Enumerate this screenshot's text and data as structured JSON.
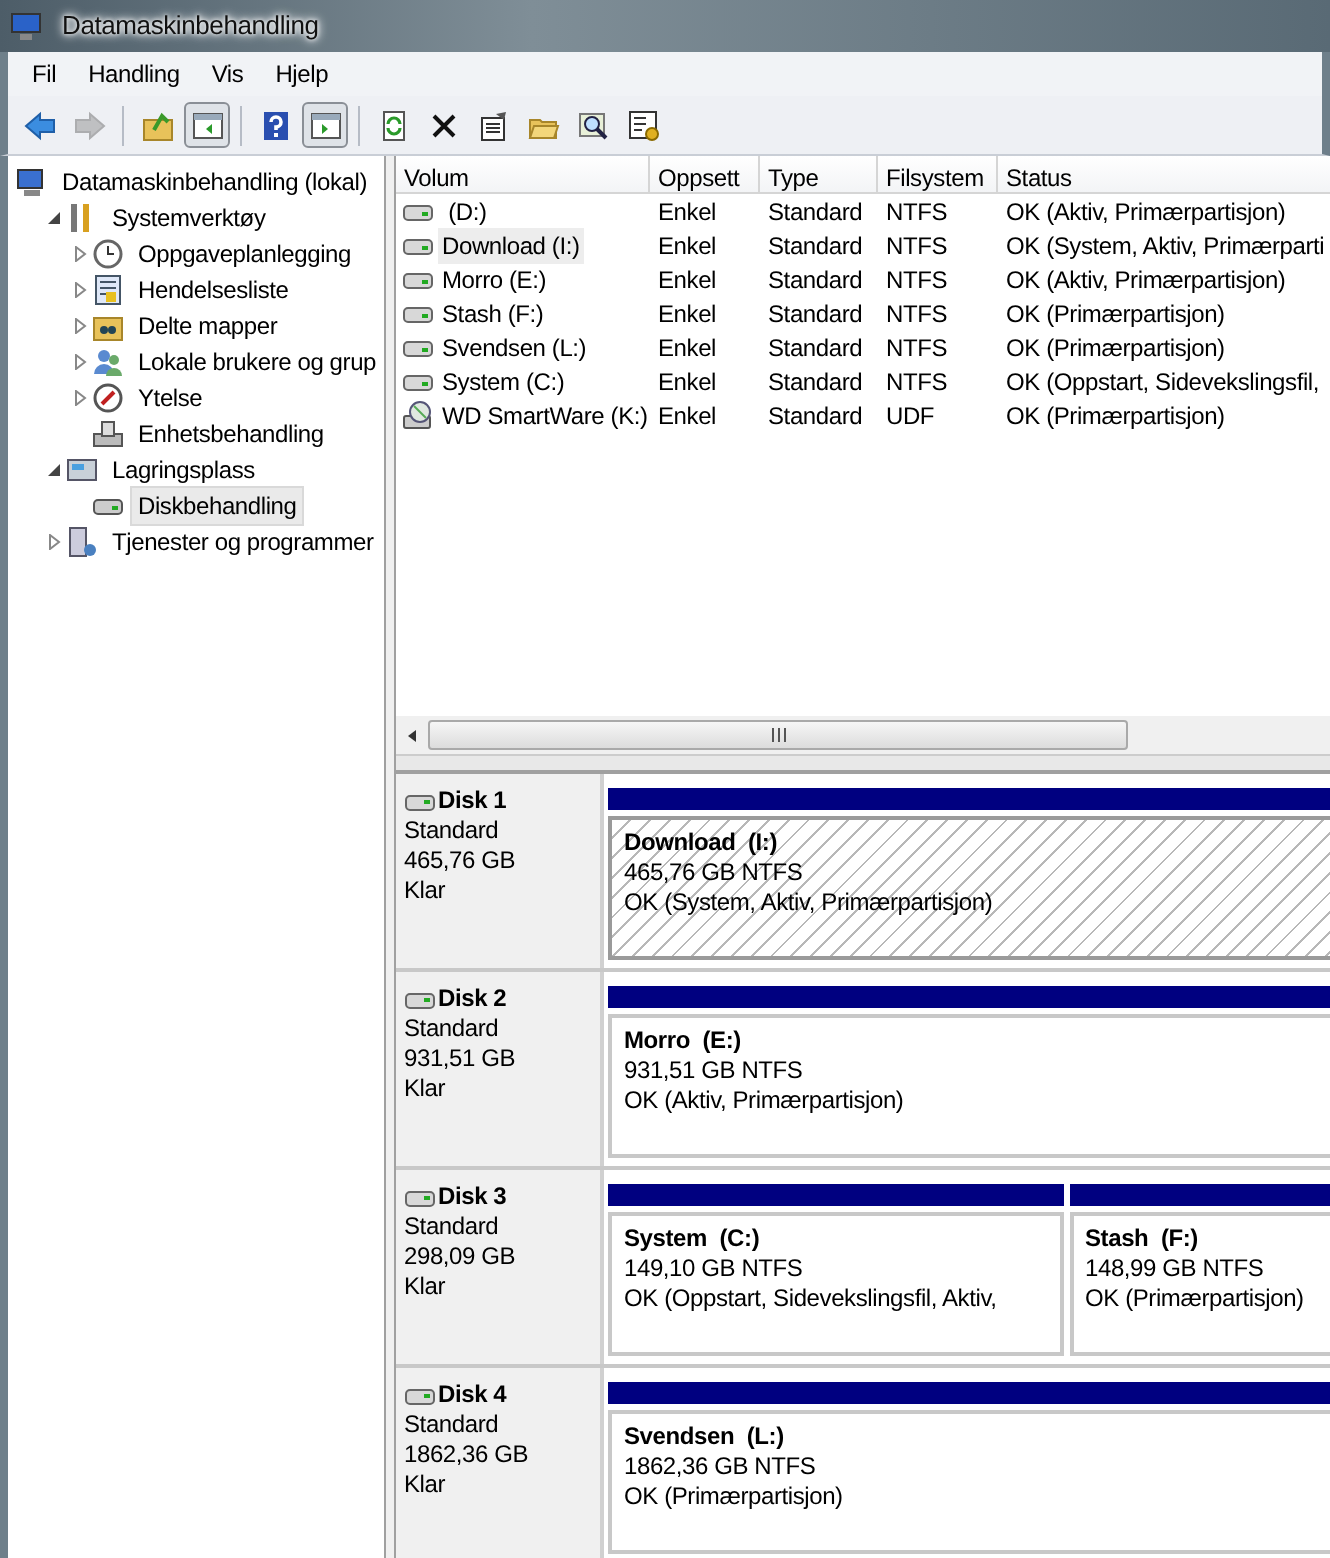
{
  "window": {
    "title": "Datamaskinbehandling"
  },
  "menu": [
    "Fil",
    "Handling",
    "Vis",
    "Hjelp"
  ],
  "toolbar_groups": [
    [
      {
        "disabled": false,
        "pressed": false
      },
      {
        "disabled": true,
        "pressed": false
      }
    ],
    [
      {
        "disabled": false,
        "pressed": false
      },
      {
        "disabled": false,
        "pressed": true
      }
    ],
    [
      {
        "disabled": false,
        "pressed": false
      },
      {
        "disabled": false,
        "pressed": true
      }
    ],
    [
      {
        "disabled": false,
        "pressed": false
      },
      {
        "disabled": false,
        "pressed": false
      },
      {
        "disabled": false,
        "pressed": false
      },
      {
        "disabled": false,
        "pressed": false
      },
      {
        "disabled": false,
        "pressed": false
      },
      {
        "disabled": false,
        "pressed": false
      }
    ]
  ],
  "tree": [
    {
      "label": "Datamaskinbehandling (lokal)",
      "kind": "root",
      "selected": false,
      "children": [
        {
          "label": "Systemverktøy",
          "kind": "branch",
          "expanded": true,
          "selected": false,
          "children": [
            {
              "label": "Oppgaveplanlegging",
              "kind": "branch",
              "expanded": false,
              "selected": false
            },
            {
              "label": "Hendelsesliste",
              "kind": "branch",
              "expanded": false,
              "selected": false
            },
            {
              "label": "Delte mapper",
              "kind": "branch",
              "expanded": false,
              "selected": false
            },
            {
              "label": "Lokale brukere og grup",
              "kind": "branch",
              "expanded": false,
              "selected": false
            },
            {
              "label": "Ytelse",
              "kind": "branch",
              "expanded": false,
              "selected": false
            },
            {
              "label": "Enhetsbehandling",
              "kind": "leaf",
              "selected": false
            }
          ]
        },
        {
          "label": "Lagringsplass",
          "kind": "branch",
          "expanded": true,
          "selected": false,
          "children": [
            {
              "label": "Diskbehandling",
              "kind": "leaf",
              "selected": true
            }
          ]
        },
        {
          "label": "Tjenester og programmer",
          "kind": "branch",
          "expanded": false,
          "selected": false
        }
      ]
    }
  ],
  "volumes": {
    "columns": [
      "Volum",
      "Oppsett",
      "Type",
      "Filsystem",
      "Status"
    ],
    "rows": [
      {
        "kind": "hdd",
        "selected": false,
        "cells": [
          " (D:)",
          "Enkel",
          "Standard",
          "NTFS",
          "OK (Aktiv, Primærpartisjon)"
        ]
      },
      {
        "kind": "hdd",
        "selected": true,
        "cells": [
          "Download (I:)",
          "Enkel",
          "Standard",
          "NTFS",
          "OK (System, Aktiv, Primærparti"
        ]
      },
      {
        "kind": "hdd",
        "selected": false,
        "cells": [
          "Morro (E:)",
          "Enkel",
          "Standard",
          "NTFS",
          "OK (Aktiv, Primærpartisjon)"
        ]
      },
      {
        "kind": "hdd",
        "selected": false,
        "cells": [
          "Stash (F:)",
          "Enkel",
          "Standard",
          "NTFS",
          "OK (Primærpartisjon)"
        ]
      },
      {
        "kind": "hdd",
        "selected": false,
        "cells": [
          "Svendsen (L:)",
          "Enkel",
          "Standard",
          "NTFS",
          "OK (Primærpartisjon)"
        ]
      },
      {
        "kind": "hdd",
        "selected": false,
        "cells": [
          "System (C:)",
          "Enkel",
          "Standard",
          "NTFS",
          "OK (Oppstart, Sidevekslingsfil,"
        ]
      },
      {
        "kind": "optical",
        "selected": false,
        "cells": [
          "WD SmartWare (K:)",
          "Enkel",
          "Standard",
          "UDF",
          "OK (Primærpartisjon)"
        ]
      }
    ]
  },
  "disks": [
    {
      "name": "Disk 1",
      "type": "Standard",
      "size": "465,76 GB",
      "state": "Klar",
      "partitions": [
        {
          "title": "Download  (I:)",
          "info": "465,76 GB NTFS",
          "status": "OK (System, Aktiv, Primærpartisjon)",
          "selected": true
        }
      ]
    },
    {
      "name": "Disk 2",
      "type": "Standard",
      "size": "931,51 GB",
      "state": "Klar",
      "partitions": [
        {
          "title": "Morro  (E:)",
          "info": "931,51 GB NTFS",
          "status": "OK (Aktiv, Primærpartisjon)",
          "selected": false
        }
      ]
    },
    {
      "name": "Disk 3",
      "type": "Standard",
      "size": "298,09 GB",
      "state": "Klar",
      "partitions": [
        {
          "title": "System  (C:)",
          "info": "149,10 GB NTFS",
          "status": "OK (Oppstart, Sidevekslingsfil, Aktiv,",
          "selected": false
        },
        {
          "title": "Stash  (F:)",
          "info": "148,99 GB NTFS",
          "status": "OK (Primærpartisjon)",
          "selected": false
        }
      ]
    },
    {
      "name": "Disk 4",
      "type": "Standard",
      "size": "1862,36 GB",
      "state": "Klar",
      "partitions": [
        {
          "title": "Svendsen  (L:)",
          "info": "1862,36 GB NTFS",
          "status": "OK (Primærpartisjon)",
          "selected": false
        }
      ]
    }
  ]
}
